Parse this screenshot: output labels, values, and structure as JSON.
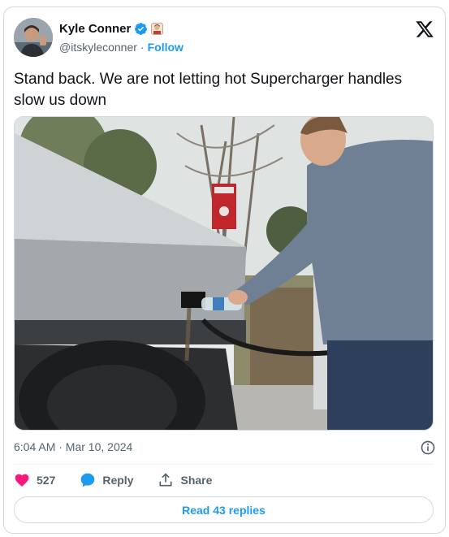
{
  "author": {
    "name": "Kyle Conner",
    "handle": "@itskyleconner",
    "separator": "·",
    "follow_label": "Follow"
  },
  "tweet": {
    "text": "Stand back. We are not letting hot Supercharger handles slow us down",
    "timestamp": "6:04 AM · Mar 10, 2024"
  },
  "actions": {
    "likes": "527",
    "reply_label": "Reply",
    "share_label": "Share"
  },
  "read_replies_label": "Read 43 replies",
  "colors": {
    "accent": "#1d9bf0",
    "like": "#f91880",
    "secondary_text": "#536471",
    "border": "#cfd9de"
  },
  "icons": [
    "verified-badge-icon",
    "x-logo-icon",
    "info-icon",
    "heart-icon",
    "reply-bubble-icon",
    "share-icon"
  ]
}
